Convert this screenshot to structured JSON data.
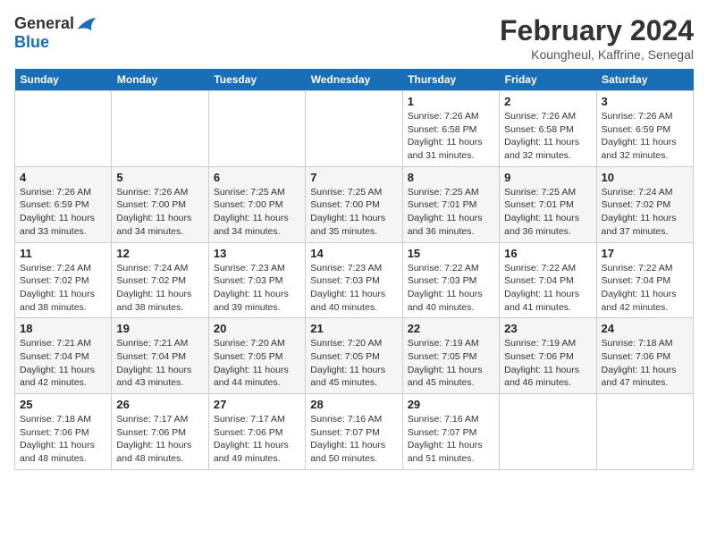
{
  "header": {
    "logo_general": "General",
    "logo_blue": "Blue",
    "month_year": "February 2024",
    "location": "Koungheul, Kaffrine, Senegal"
  },
  "days_of_week": [
    "Sunday",
    "Monday",
    "Tuesday",
    "Wednesday",
    "Thursday",
    "Friday",
    "Saturday"
  ],
  "weeks": [
    [
      {
        "day": "",
        "info": ""
      },
      {
        "day": "",
        "info": ""
      },
      {
        "day": "",
        "info": ""
      },
      {
        "day": "",
        "info": ""
      },
      {
        "day": "1",
        "info": "Sunrise: 7:26 AM\nSunset: 6:58 PM\nDaylight: 11 hours and 31 minutes."
      },
      {
        "day": "2",
        "info": "Sunrise: 7:26 AM\nSunset: 6:58 PM\nDaylight: 11 hours and 32 minutes."
      },
      {
        "day": "3",
        "info": "Sunrise: 7:26 AM\nSunset: 6:59 PM\nDaylight: 11 hours and 32 minutes."
      }
    ],
    [
      {
        "day": "4",
        "info": "Sunrise: 7:26 AM\nSunset: 6:59 PM\nDaylight: 11 hours and 33 minutes."
      },
      {
        "day": "5",
        "info": "Sunrise: 7:26 AM\nSunset: 7:00 PM\nDaylight: 11 hours and 34 minutes."
      },
      {
        "day": "6",
        "info": "Sunrise: 7:25 AM\nSunset: 7:00 PM\nDaylight: 11 hours and 34 minutes."
      },
      {
        "day": "7",
        "info": "Sunrise: 7:25 AM\nSunset: 7:00 PM\nDaylight: 11 hours and 35 minutes."
      },
      {
        "day": "8",
        "info": "Sunrise: 7:25 AM\nSunset: 7:01 PM\nDaylight: 11 hours and 36 minutes."
      },
      {
        "day": "9",
        "info": "Sunrise: 7:25 AM\nSunset: 7:01 PM\nDaylight: 11 hours and 36 minutes."
      },
      {
        "day": "10",
        "info": "Sunrise: 7:24 AM\nSunset: 7:02 PM\nDaylight: 11 hours and 37 minutes."
      }
    ],
    [
      {
        "day": "11",
        "info": "Sunrise: 7:24 AM\nSunset: 7:02 PM\nDaylight: 11 hours and 38 minutes."
      },
      {
        "day": "12",
        "info": "Sunrise: 7:24 AM\nSunset: 7:02 PM\nDaylight: 11 hours and 38 minutes."
      },
      {
        "day": "13",
        "info": "Sunrise: 7:23 AM\nSunset: 7:03 PM\nDaylight: 11 hours and 39 minutes."
      },
      {
        "day": "14",
        "info": "Sunrise: 7:23 AM\nSunset: 7:03 PM\nDaylight: 11 hours and 40 minutes."
      },
      {
        "day": "15",
        "info": "Sunrise: 7:22 AM\nSunset: 7:03 PM\nDaylight: 11 hours and 40 minutes."
      },
      {
        "day": "16",
        "info": "Sunrise: 7:22 AM\nSunset: 7:04 PM\nDaylight: 11 hours and 41 minutes."
      },
      {
        "day": "17",
        "info": "Sunrise: 7:22 AM\nSunset: 7:04 PM\nDaylight: 11 hours and 42 minutes."
      }
    ],
    [
      {
        "day": "18",
        "info": "Sunrise: 7:21 AM\nSunset: 7:04 PM\nDaylight: 11 hours and 42 minutes."
      },
      {
        "day": "19",
        "info": "Sunrise: 7:21 AM\nSunset: 7:04 PM\nDaylight: 11 hours and 43 minutes."
      },
      {
        "day": "20",
        "info": "Sunrise: 7:20 AM\nSunset: 7:05 PM\nDaylight: 11 hours and 44 minutes."
      },
      {
        "day": "21",
        "info": "Sunrise: 7:20 AM\nSunset: 7:05 PM\nDaylight: 11 hours and 45 minutes."
      },
      {
        "day": "22",
        "info": "Sunrise: 7:19 AM\nSunset: 7:05 PM\nDaylight: 11 hours and 45 minutes."
      },
      {
        "day": "23",
        "info": "Sunrise: 7:19 AM\nSunset: 7:06 PM\nDaylight: 11 hours and 46 minutes."
      },
      {
        "day": "24",
        "info": "Sunrise: 7:18 AM\nSunset: 7:06 PM\nDaylight: 11 hours and 47 minutes."
      }
    ],
    [
      {
        "day": "25",
        "info": "Sunrise: 7:18 AM\nSunset: 7:06 PM\nDaylight: 11 hours and 48 minutes."
      },
      {
        "day": "26",
        "info": "Sunrise: 7:17 AM\nSunset: 7:06 PM\nDaylight: 11 hours and 48 minutes."
      },
      {
        "day": "27",
        "info": "Sunrise: 7:17 AM\nSunset: 7:06 PM\nDaylight: 11 hours and 49 minutes."
      },
      {
        "day": "28",
        "info": "Sunrise: 7:16 AM\nSunset: 7:07 PM\nDaylight: 11 hours and 50 minutes."
      },
      {
        "day": "29",
        "info": "Sunrise: 7:16 AM\nSunset: 7:07 PM\nDaylight: 11 hours and 51 minutes."
      },
      {
        "day": "",
        "info": ""
      },
      {
        "day": "",
        "info": ""
      }
    ]
  ]
}
